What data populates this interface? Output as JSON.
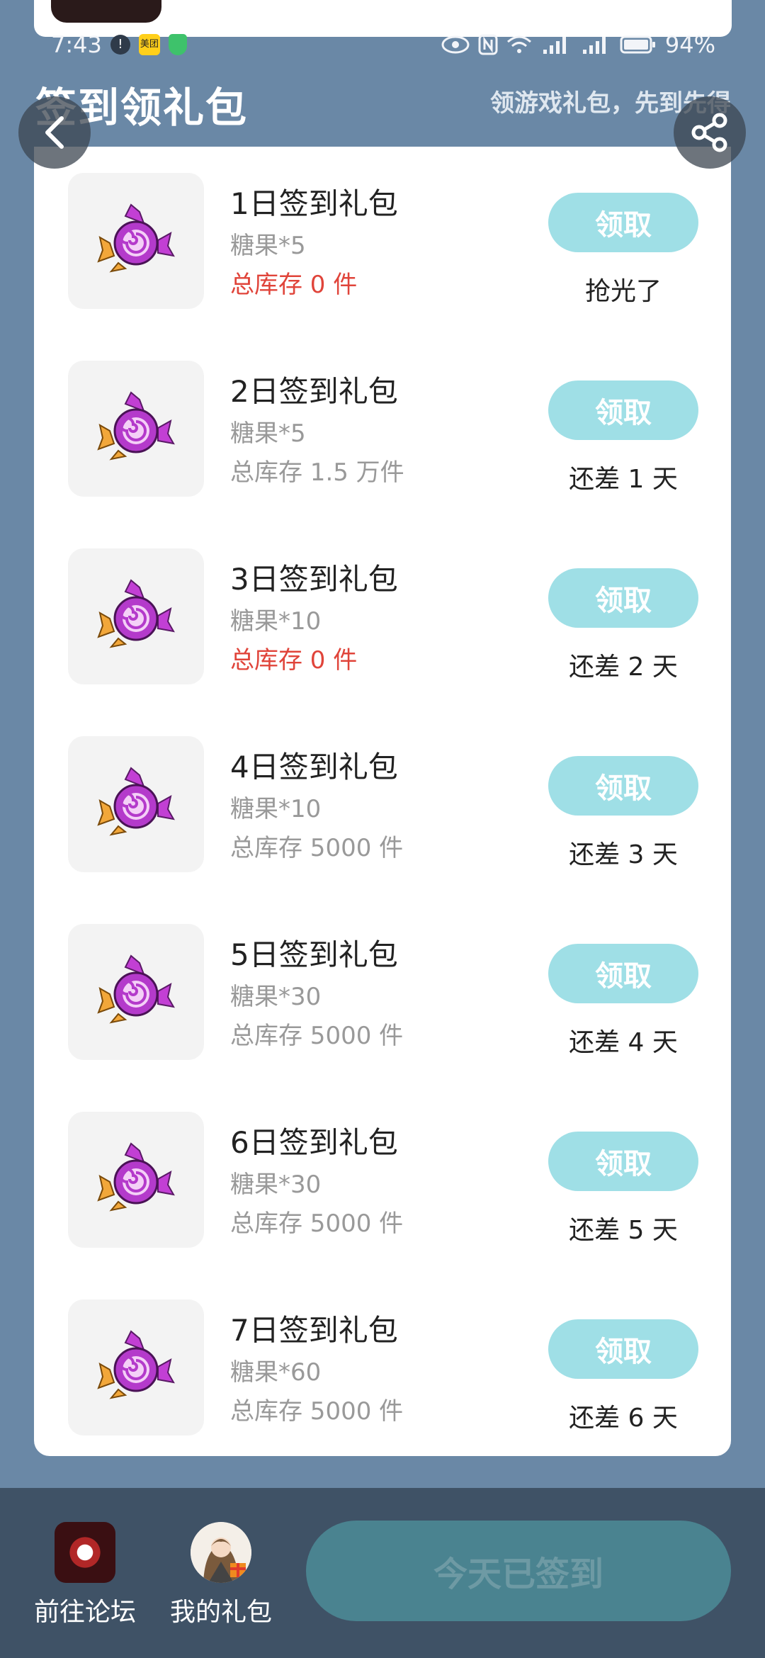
{
  "status_bar": {
    "time": "7:43",
    "meituan_label": "美团",
    "battery": "94%"
  },
  "header": {
    "title": "签到领礼包",
    "subtitle": "领游戏礼包，先到先得"
  },
  "gifts": [
    {
      "title": "1日签到礼包",
      "qty": "糖果*5",
      "stock": "总库存 0 件",
      "stock_empty": true,
      "button": "领取",
      "status": "抢光了"
    },
    {
      "title": "2日签到礼包",
      "qty": "糖果*5",
      "stock": "总库存 1.5 万件",
      "stock_empty": false,
      "button": "领取",
      "status": "还差 1 天"
    },
    {
      "title": "3日签到礼包",
      "qty": "糖果*10",
      "stock": "总库存 0 件",
      "stock_empty": true,
      "button": "领取",
      "status": "还差 2 天"
    },
    {
      "title": "4日签到礼包",
      "qty": "糖果*10",
      "stock": "总库存 5000 件",
      "stock_empty": false,
      "button": "领取",
      "status": "还差 3 天"
    },
    {
      "title": "5日签到礼包",
      "qty": "糖果*30",
      "stock": "总库存 5000 件",
      "stock_empty": false,
      "button": "领取",
      "status": "还差 4 天"
    },
    {
      "title": "6日签到礼包",
      "qty": "糖果*30",
      "stock": "总库存 5000 件",
      "stock_empty": false,
      "button": "领取",
      "status": "还差 5 天"
    },
    {
      "title": "7日签到礼包",
      "qty": "糖果*60",
      "stock": "总库存 5000 件",
      "stock_empty": false,
      "button": "领取",
      "status": "还差 6 天"
    }
  ],
  "bottom_bar": {
    "forum_label": "前往论坛",
    "my_gifts_label": "我的礼包",
    "checkin_label": "今天已签到"
  },
  "colors": {
    "background": "#6a88a6",
    "claim_button": "#9fdfe6",
    "stock_empty": "#e0443a",
    "bottom_bar": "#3f5266",
    "checkin_button": "#4a8390"
  }
}
